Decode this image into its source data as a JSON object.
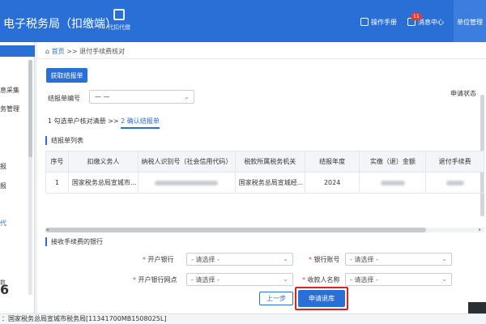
{
  "header": {
    "title": "电子税务局（扣缴端）",
    "proxy_tab": "代扣代缴",
    "manual": "操作手册",
    "messages": "消息中心",
    "message_count": "11",
    "unit": "单位管理"
  },
  "sidebar": {
    "items": [
      "息采集",
      "务管理",
      "报",
      "报",
      "代"
    ],
    "stat_label": "数",
    "stat_value": "6"
  },
  "breadcrumb": {
    "home": "首页",
    "sep": ">>",
    "current": "退付手续费核对"
  },
  "toolbar": {
    "fetch_button": "获取结报单"
  },
  "report": {
    "label": "结报单编号",
    "value": "— —",
    "status_label": "申请状态"
  },
  "steps": {
    "step1": "1 勾选单户核对清册",
    "sep": ">>",
    "step2": "2 确认结报单"
  },
  "table": {
    "section_title": "结报单列表",
    "columns": [
      "序号",
      "扣缴义务人",
      "纳税人识别号（社会信用代码）",
      "税款所属税务机关",
      "结报年度",
      "实缴（退）金额",
      "退付手续费"
    ],
    "rows": [
      {
        "index": "1",
        "agent": "国家税务总局宣城市...",
        "authority": "国家税务总局宣城经...",
        "year": "2024"
      }
    ]
  },
  "bank": {
    "section_title": "接收手续费的银行",
    "fields": [
      {
        "label": "开户银行",
        "value": "- 请选择 -"
      },
      {
        "label": "银行账号",
        "value": "- 请选择 -"
      },
      {
        "label": "开户银行网点",
        "value": "- 请选择 -"
      },
      {
        "label": "收款人名称",
        "value": "- 请选择 -"
      }
    ]
  },
  "actions": {
    "prev": "上一步",
    "apply": "申请退库"
  },
  "footer": {
    "text": "：国家税务总局宣城市税务局[11341700MB1508025L]"
  },
  "colors": {
    "primary": "#2a6fd6",
    "highlight": "#e02020"
  }
}
